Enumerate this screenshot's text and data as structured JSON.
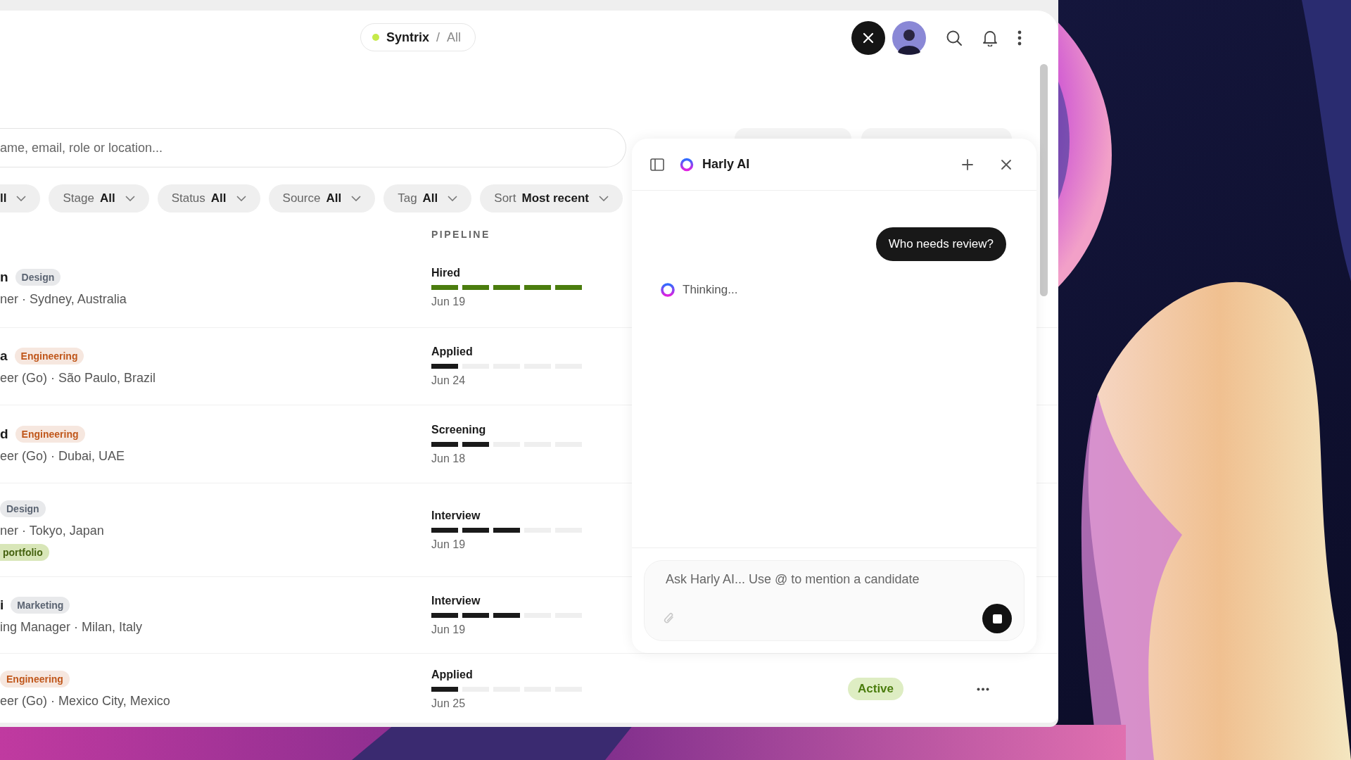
{
  "breadcrumb": {
    "workspace": "Syntrix",
    "separator": "/",
    "view": "All",
    "color": "#c6ea4a"
  },
  "search": {
    "placeholder": "ame, email, role or location..."
  },
  "filters": [
    {
      "value": "ll"
    },
    {
      "label": "Stage",
      "value": "All"
    },
    {
      "label": "Status",
      "value": "All"
    },
    {
      "label": "Source",
      "value": "All"
    },
    {
      "label": "Tag",
      "value": "All"
    },
    {
      "label": "Sort",
      "value": "Most recent"
    }
  ],
  "table": {
    "pipeline_heading": "PIPELINE",
    "rows": [
      {
        "name": "n",
        "tags": [
          {
            "text": "Design",
            "color": "#5b6472"
          }
        ],
        "subtitle": "ner · Sydney, Australia",
        "pipeline": {
          "stage": "Hired",
          "level": 1,
          "color": "#4b7d0e",
          "date": "Jun 19"
        }
      },
      {
        "name": "a",
        "tags": [
          {
            "text": "Engineering",
            "color": "#c0571b"
          }
        ],
        "subtitle": "eer (Go) · São Paulo, Brazil",
        "pipeline": {
          "stage": "Applied",
          "level": 0.2,
          "color": "#1a1a1a",
          "date": "Jun 24"
        }
      },
      {
        "name": "d",
        "tags": [
          {
            "text": "Engineering",
            "color": "#c0571b"
          }
        ],
        "subtitle": "eer (Go) · Dubai, UAE",
        "pipeline": {
          "stage": "Screening",
          "level": 0.4,
          "color": "#1a1a1a",
          "date": "Jun 18"
        }
      },
      {
        "tags": [
          {
            "text": "Design",
            "color": "#5b6472"
          }
        ],
        "subtitle": "ner · Tokyo, Japan",
        "notes": [
          {
            "text": "portfolio",
            "color": "#45620f"
          }
        ],
        "pipeline": {
          "stage": "Interview",
          "level": 0.6,
          "color": "#1a1a1a",
          "date": "Jun 19"
        }
      },
      {
        "name": "i",
        "tags": [
          {
            "text": "Marketing",
            "color": "#5b6472"
          }
        ],
        "subtitle": "ing Manager · Milan, Italy",
        "pipeline": {
          "stage": "Interview",
          "level": 0.6,
          "color": "#1a1a1a",
          "date": "Jun 19"
        }
      },
      {
        "tags": [
          {
            "text": "Engineering",
            "color": "#c0571b"
          }
        ],
        "subtitle": "eer (Go) · Mexico City, Mexico",
        "pipeline": {
          "stage": "Applied",
          "level": 0.2,
          "color": "#1a1a1a",
          "date": "Jun 25"
        },
        "status": {
          "text": "Active",
          "color": "#4b7d0e"
        }
      }
    ]
  },
  "assistant": {
    "title": "Harly AI",
    "messages": [
      {
        "kind": "user",
        "text": "Who needs review?"
      },
      {
        "kind": "thinking",
        "text": "Thinking..."
      }
    ],
    "input": {
      "placeholder": "Ask Harly AI... Use @ to mention a candidate"
    }
  }
}
